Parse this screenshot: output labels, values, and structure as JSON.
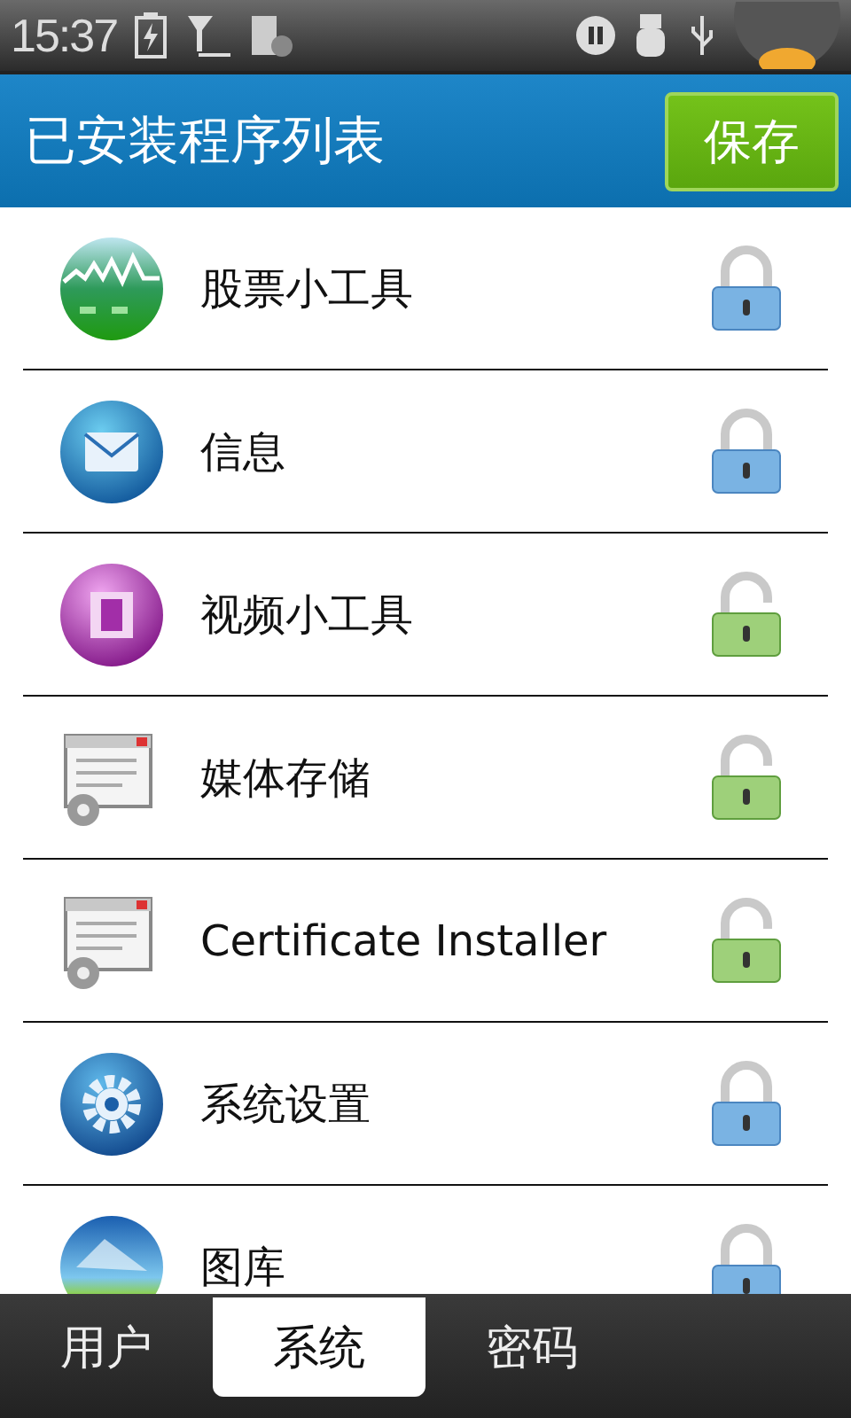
{
  "status_bar": {
    "time": "15:37"
  },
  "header": {
    "title": "已安装程序列表",
    "save_button": "保存"
  },
  "apps": [
    {
      "name": "股票小工具",
      "kind": "stock",
      "locked": true
    },
    {
      "name": "信息",
      "kind": "message",
      "locked": true
    },
    {
      "name": "视频小工具",
      "kind": "video",
      "locked": false
    },
    {
      "name": "媒体存储",
      "kind": "window",
      "locked": false
    },
    {
      "name": "Certificate Installer",
      "kind": "window",
      "locked": false
    },
    {
      "name": "系统设置",
      "kind": "settings",
      "locked": true
    },
    {
      "name": "图库",
      "kind": "gallery",
      "locked": true
    }
  ],
  "tabs": [
    {
      "label": "用户",
      "selected": false
    },
    {
      "label": "系统",
      "selected": true
    },
    {
      "label": "密码",
      "selected": false
    }
  ]
}
